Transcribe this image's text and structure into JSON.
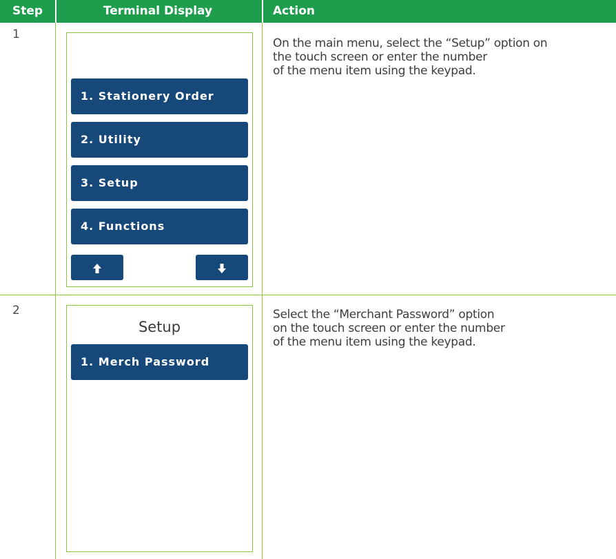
{
  "header": {
    "step": "Step",
    "terminal_display": "Terminal Display",
    "action": "Action"
  },
  "rows": [
    {
      "step": "1",
      "action": "On the main menu, select the “Setup” option on the touch screen or enter the number of the menu item using the keypad.",
      "action_lines": [
        "On the main menu, select the “Setup” option on",
        "the touch screen or enter the number",
        "of the menu item using the keypad."
      ],
      "terminal": {
        "menu_items": [
          "1. Stationery Order",
          "2. Utility",
          "3. Setup",
          "4. Functions"
        ],
        "up_arrow": "↑",
        "down_arrow": "↓"
      }
    },
    {
      "step": "2",
      "action_lines": [
        "Select the “Merchant Password” option",
        "on the touch screen or enter the number",
        "of the menu item using the keypad."
      ],
      "terminal": {
        "title": "Setup",
        "menu_items": [
          "1. Merch Password"
        ]
      }
    }
  ],
  "colors": {
    "header_bg": "#1e9e4c",
    "border": "#8cc63f",
    "button_bg": "#16487a"
  }
}
